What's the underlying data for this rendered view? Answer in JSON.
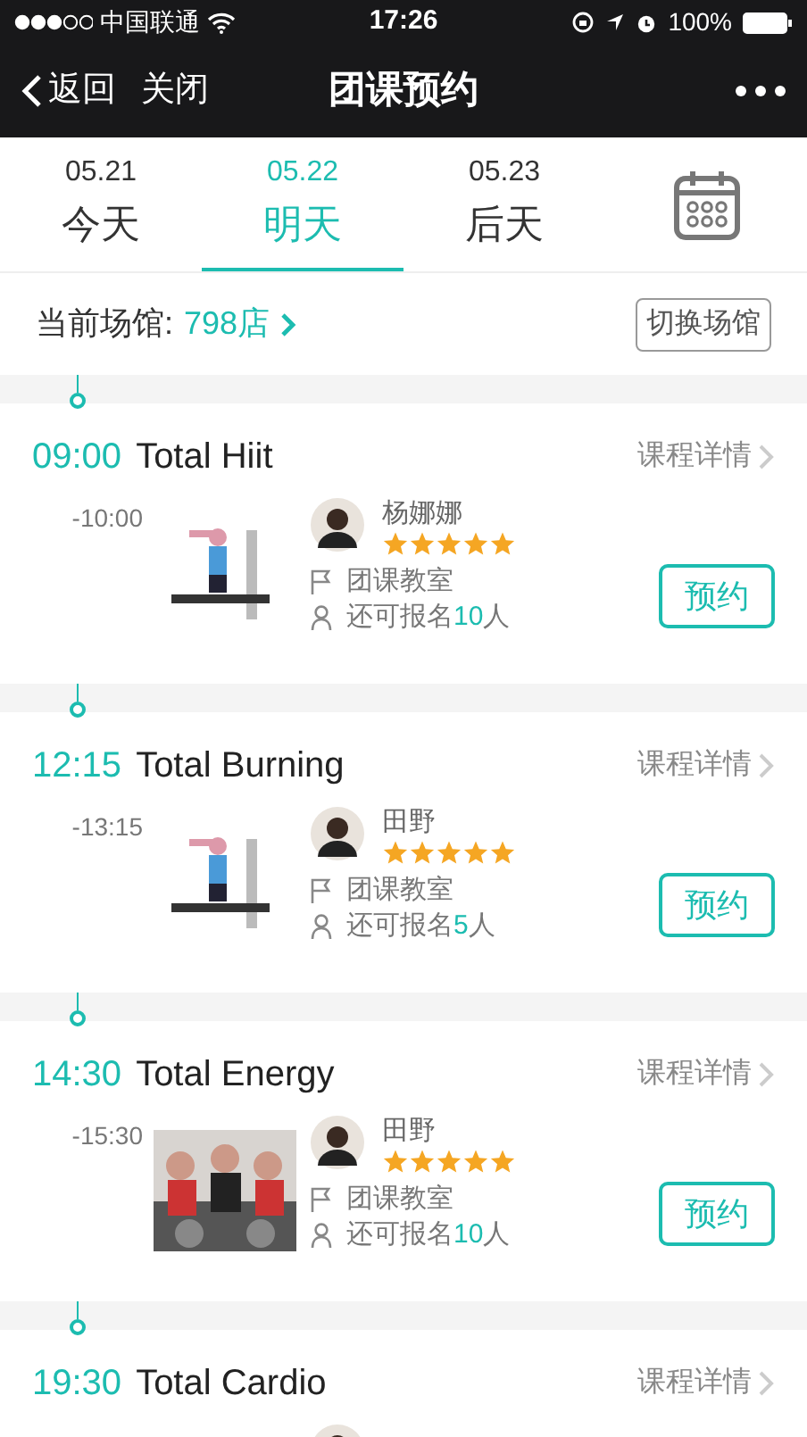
{
  "status_bar": {
    "carrier": "中国联通",
    "time": "17:26",
    "battery": "100%"
  },
  "nav": {
    "back": "返回",
    "close": "关闭",
    "title": "团课预约"
  },
  "date_tabs": [
    {
      "date": "05.21",
      "label": "今天",
      "selected": false
    },
    {
      "date": "05.22",
      "label": "明天",
      "selected": true
    },
    {
      "date": "05.23",
      "label": "后天",
      "selected": false
    }
  ],
  "venue": {
    "label": "当前场馆:",
    "name": "798店",
    "switch": "切换场馆"
  },
  "classes": [
    {
      "start": "09:00",
      "title": "Total Hiit",
      "end": "-10:00",
      "detail": "课程详情",
      "coach": "杨娜娜",
      "stars": 5,
      "room": "团课教室",
      "spots_prefix": "还可报名",
      "spots": "10",
      "spots_suffix": "人",
      "book": "预约"
    },
    {
      "start": "12:15",
      "title": "Total Burning",
      "end": "-13:15",
      "detail": "课程详情",
      "coach": "田野",
      "stars": 5,
      "room": "团课教室",
      "spots_prefix": "还可报名",
      "spots": "5",
      "spots_suffix": "人",
      "book": "预约"
    },
    {
      "start": "14:30",
      "title": "Total Energy",
      "end": "-15:30",
      "detail": "课程详情",
      "coach": "田野",
      "stars": 5,
      "room": "团课教室",
      "spots_prefix": "还可报名",
      "spots": "10",
      "spots_suffix": "人",
      "book": "预约"
    },
    {
      "start": "19:30",
      "title": "Total Cardio",
      "detail": "课程详情"
    }
  ]
}
